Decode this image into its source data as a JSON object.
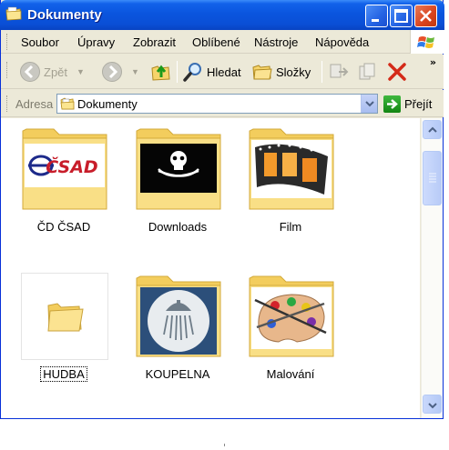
{
  "window": {
    "title": "Dokumenty",
    "buttons": {
      "minimize": "minimize",
      "maximize": "maximize",
      "close": "close"
    }
  },
  "menu": {
    "items": [
      {
        "label": "Soubor"
      },
      {
        "label": "Úpravy"
      },
      {
        "label": "Zobrazit"
      },
      {
        "label": "Oblíbené"
      },
      {
        "label": "Nástroje"
      },
      {
        "label": "Nápověda"
      }
    ]
  },
  "toolbar": {
    "back_label": "Zpět",
    "search_label": "Hledat",
    "folders_label": "Složky"
  },
  "address": {
    "label": "Adresa",
    "value": "Dokumenty",
    "go_label": "Přejít"
  },
  "items": [
    {
      "label": "ČD ČSAD",
      "icon": "csad-logo-folder-icon",
      "thumb_text": "ČSAD"
    },
    {
      "label": "Downloads",
      "icon": "pirate-flag-folder-icon"
    },
    {
      "label": "Film",
      "icon": "film-strip-folder-icon"
    },
    {
      "label": "HUDBA",
      "icon": "plain-folder-icon",
      "selected": true
    },
    {
      "label": "KOUPELNA",
      "icon": "shower-folder-icon"
    },
    {
      "label": "Malování",
      "icon": "paint-palette-folder-icon"
    }
  ],
  "colors": {
    "titlebar": "#0a55de",
    "window_bg": "#ece9d8",
    "folder": "#f7d774",
    "close_button": "#d9431d"
  }
}
